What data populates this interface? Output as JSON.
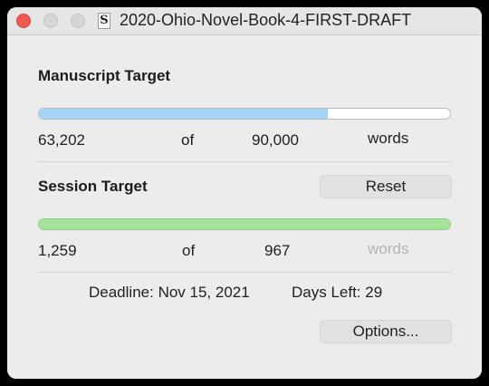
{
  "window": {
    "title": "2020-Ohio-Novel-Book-4-FIRST-DRAFT",
    "doc_icon_glyph": "S"
  },
  "manuscript": {
    "heading": "Manuscript Target",
    "current": "63,202",
    "of_label": "of",
    "target": "90,000",
    "unit": "words",
    "progress_fraction": 0.7022
  },
  "session": {
    "heading": "Session Target",
    "reset_label": "Reset",
    "current": "1,259",
    "of_label": "of",
    "target": "967",
    "unit": "words",
    "progress_fraction": 1.0
  },
  "footer": {
    "deadline_label": "Deadline:",
    "deadline_value": "Nov 15, 2021",
    "days_left_label": "Days Left:",
    "days_left_value": "29",
    "options_label": "Options..."
  },
  "colors": {
    "manuscript_bar": "#a3d6f5",
    "session_bar": "#a6e39a",
    "close_button": "#ee5a52"
  }
}
